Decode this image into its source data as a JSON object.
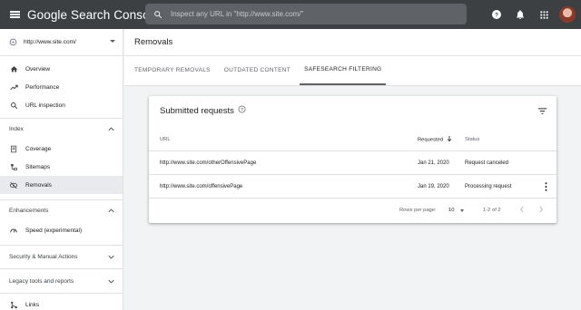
{
  "topbar": {
    "app_title": "Google Search Console",
    "search_placeholder": "Inspect any URL in \"http://www.site.com/\""
  },
  "sidebar": {
    "property": "http://www.site.com/",
    "items": [
      {
        "label": "Overview",
        "icon": "home-icon"
      },
      {
        "label": "Performance",
        "icon": "trending-up-icon"
      },
      {
        "label": "URL inspection",
        "icon": "search-icon"
      }
    ],
    "index": {
      "label": "Index",
      "items": [
        {
          "label": "Coverage",
          "icon": "coverage-icon"
        },
        {
          "label": "Sitemaps",
          "icon": "sitemap-icon"
        },
        {
          "label": "Removals",
          "icon": "visibility-off-icon",
          "active": true
        }
      ]
    },
    "enhancements": {
      "label": "Enhancements",
      "items": [
        {
          "label": "Speed (experimental)",
          "icon": "speed-icon"
        }
      ]
    },
    "security_label": "Security & Manual Actions",
    "legacy_label": "Legacy tools and reports",
    "links_label": "Links"
  },
  "main": {
    "page_title": "Removals",
    "tabs": [
      "TEMPORARY REMOVALS",
      "OUTDATED CONTENT",
      "SAFESEARCH FILTERING"
    ],
    "active_tab": "SAFESEARCH FILTERING"
  },
  "card": {
    "title": "Submitted requests",
    "columns": {
      "url": "URL",
      "requested": "Requested",
      "status": "Status"
    },
    "rows": [
      {
        "url": "http://www.site.com/otherOffensivePage",
        "requested": "Jan 21, 2020",
        "status": "Request canceled"
      },
      {
        "url": "http://www.site.com/offensivePage",
        "requested": "Jan 19, 2020",
        "status": "Processing request"
      }
    ],
    "footer": {
      "rows_per_page_label": "Rows per page:",
      "rows_per_page": "10",
      "range": "1-2 of 2"
    }
  },
  "colors": {
    "topbar_bg": "#3c4043",
    "search_bg": "#5f6368",
    "active_nav_bg": "#e8eaed",
    "page_bg": "#f1f3f4"
  }
}
